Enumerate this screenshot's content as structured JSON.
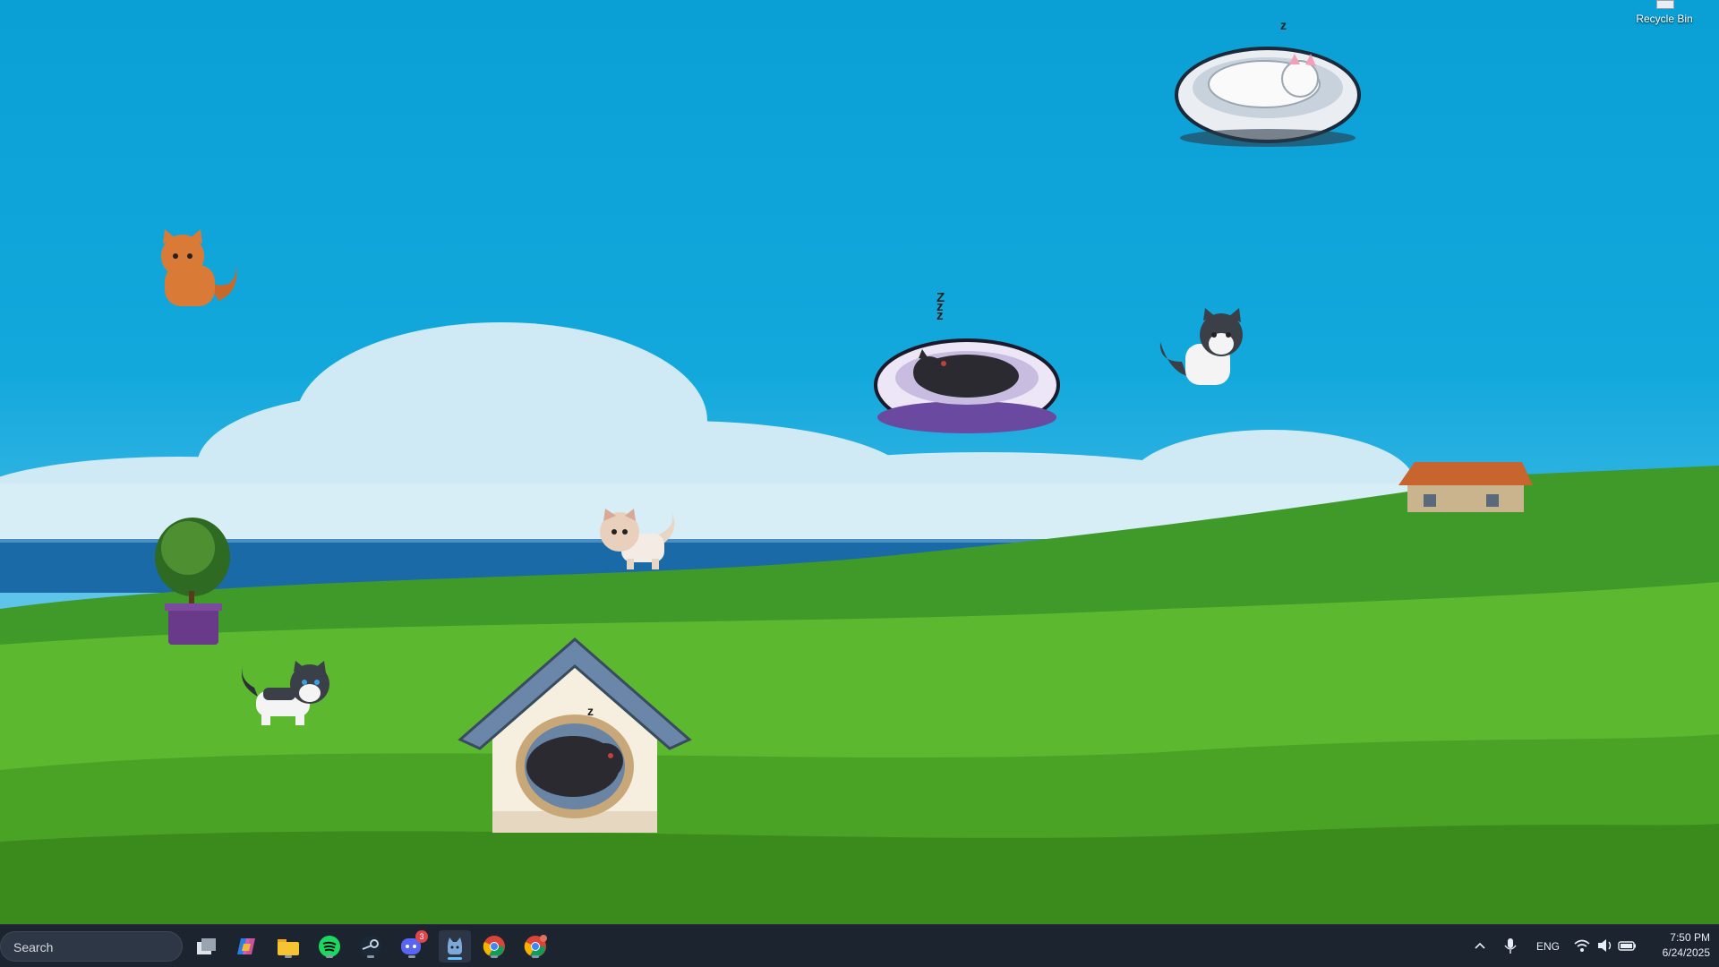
{
  "desktop": {
    "recycle_bin_label": "Recycle Bin",
    "sleep_marks": [
      "Z",
      "z",
      "z"
    ]
  },
  "taskbar": {
    "search_placeholder": "Search",
    "apps": [
      {
        "name": "task-view",
        "icon": "task-view-icon"
      },
      {
        "name": "copilot",
        "icon": "copilot-icon"
      },
      {
        "name": "file-explorer",
        "icon": "folder-icon"
      },
      {
        "name": "spotify",
        "icon": "spotify-icon"
      },
      {
        "name": "steam",
        "icon": "steam-icon"
      },
      {
        "name": "discord",
        "icon": "discord-icon",
        "badge": "3"
      },
      {
        "name": "desktop-pet",
        "icon": "pet-app-icon"
      },
      {
        "name": "chrome",
        "icon": "chrome-icon"
      },
      {
        "name": "chrome-profile",
        "icon": "chrome-icon"
      }
    ],
    "tray": {
      "language": "ENG",
      "time": "7:50 PM",
      "date": "6/24/2025"
    }
  },
  "colors": {
    "taskbar_bg": "#1c2430",
    "sky": "#0aa0d6",
    "grass": "#5cb82e",
    "sea": "#1a6aa8"
  }
}
